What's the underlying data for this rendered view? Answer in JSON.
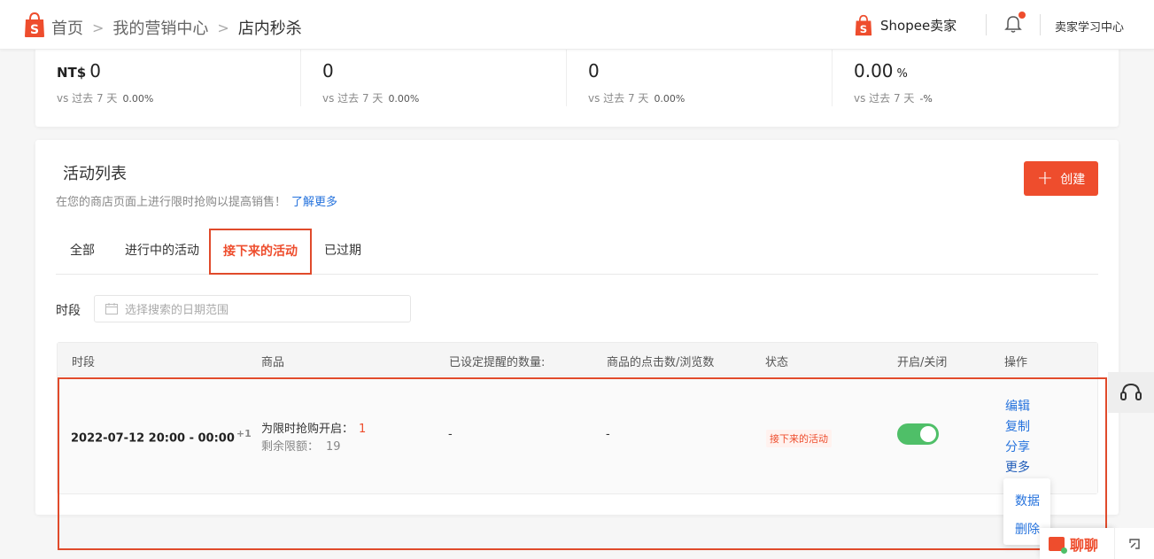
{
  "breadcrumb": {
    "home": "首页",
    "marketing": "我的营销中心",
    "current": "店内秒杀"
  },
  "header": {
    "brand": "Shopee卖家",
    "learning_center": "卖家学习中心"
  },
  "stats": [
    {
      "prefix": "NT$",
      "value": "0",
      "suffix": "",
      "compare_label": "vs 过去 7 天",
      "compare_value": "0.00%"
    },
    {
      "prefix": "",
      "value": "0",
      "suffix": "",
      "compare_label": "vs 过去 7 天",
      "compare_value": "0.00%"
    },
    {
      "prefix": "",
      "value": "0",
      "suffix": "",
      "compare_label": "vs 过去 7 天",
      "compare_value": "0.00%"
    },
    {
      "prefix": "",
      "value": "0.00",
      "suffix": "%",
      "compare_label": "vs 过去 7 天",
      "compare_value": "-%"
    }
  ],
  "activity": {
    "title": "活动列表",
    "subtitle": "在您的商店页面上进行限时抢购以提高销售！",
    "learn_more": "了解更多",
    "create_label": "创建",
    "tabs": [
      "全部",
      "进行中的活动",
      "接下来的活动",
      "已过期"
    ],
    "period_label": "时段",
    "date_placeholder": "选择搜索的日期范围",
    "columns": [
      "时段",
      "商品",
      "已设定提醒的数量:",
      "商品的点击数/浏览数",
      "状态",
      "开启/关闭",
      "操作"
    ],
    "row": {
      "period": "2022-07-12 20:00 - 00:00",
      "period_extra": "+1",
      "product_line1": "为限时抢购开启：",
      "product_count": "1",
      "product_line2": "剩余限额：",
      "product_remaining": "19",
      "reminders": "-",
      "clicks": "-",
      "status": "接下来的活动",
      "enabled": true,
      "actions": [
        "编辑",
        "复制",
        "分享",
        "更多"
      ]
    },
    "more_menu": [
      "数据",
      "删除"
    ]
  },
  "chat": {
    "label": "聊聊"
  },
  "colors": {
    "accent": "#ee4d2d",
    "link": "#2673dd",
    "toggle_on": "#4fbf68"
  }
}
